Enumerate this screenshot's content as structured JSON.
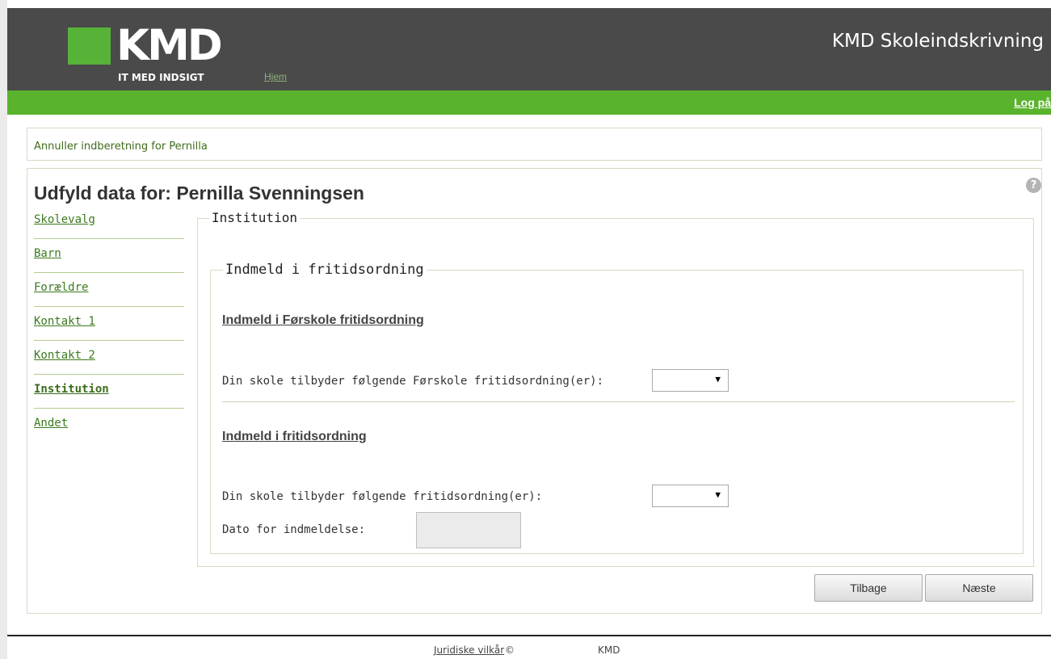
{
  "header": {
    "logo_text": "KMD",
    "logo_tagline": "IT MED INDSIGT",
    "nav_home": "Hjem",
    "app_title": "KMD Skoleindskrivning",
    "login_link": "Log på"
  },
  "cancel_link": "Annuller indberetning for Pernilla",
  "page_title": "Udfyld data for: Pernilla Svenningsen",
  "help_icon_glyph": "?",
  "sidebar": {
    "items": [
      {
        "label": "Skolevalg",
        "active": false
      },
      {
        "label": "Barn",
        "active": false
      },
      {
        "label": "Forældre",
        "active": false
      },
      {
        "label": "Kontakt 1",
        "active": false
      },
      {
        "label": "Kontakt 2",
        "active": false
      },
      {
        "label": "Institution",
        "active": true
      },
      {
        "label": "Andet",
        "active": false
      }
    ]
  },
  "form": {
    "fieldset_title": "Institution",
    "inner_fieldset_title": "Indmeld i fritidsordning",
    "preschool_section": {
      "heading": "Indmeld i Førskole fritidsordning",
      "label": "Din skole tilbyder følgende Førskole fritidsordning(er):",
      "selected_value": ""
    },
    "afterschool_section": {
      "heading": "Indmeld i fritidsordning",
      "label": "Din skole tilbyder følgende fritidsordning(er):",
      "selected_value": ""
    },
    "date_label": "Dato for indmeldelse:",
    "date_value": "",
    "dropdown_arrow": "▼"
  },
  "buttons": {
    "back": "Tilbage",
    "next": "Næste"
  },
  "footer": {
    "legal_link": "Juridiske vilkår",
    "copyright": "©",
    "company": "KMD"
  },
  "colors": {
    "header_bg": "#4a4a4a",
    "brand_green": "#59b32c",
    "link_green": "#3b7a1e"
  }
}
